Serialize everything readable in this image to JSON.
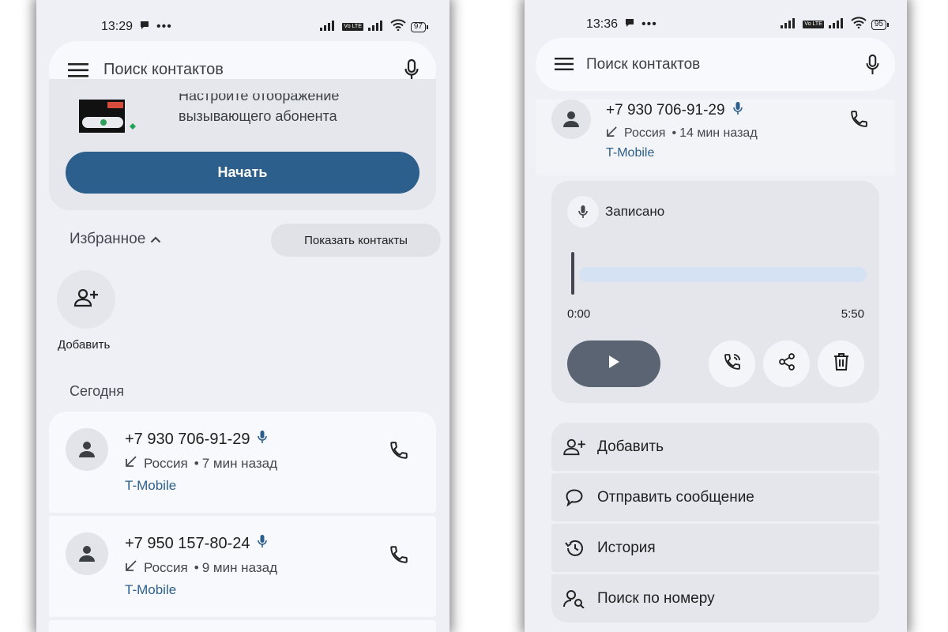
{
  "left": {
    "status": {
      "time": "13:29",
      "battery": "97",
      "volte": "Vo LTE"
    },
    "search": {
      "placeholder": "Поиск контактов"
    },
    "banner": {
      "line1": "Настройте отображение",
      "line2": "вызывающего абонента",
      "start_label": "Начать"
    },
    "favorites": {
      "label": "Избранное",
      "show_contacts": "Показать контакты",
      "add_label": "Добавить"
    },
    "today_label": "Сегодня",
    "calls": [
      {
        "number": "+7 930 706-91-29",
        "country": "Россия",
        "time": "7 мин назад",
        "carrier": "T-Mobile"
      },
      {
        "number": "+7 950 157-80-24",
        "country": "Россия",
        "time": "9 мин назад",
        "carrier": "T-Mobile"
      }
    ]
  },
  "right": {
    "status": {
      "time": "13:36",
      "battery": "95",
      "volte": "Vo LTE"
    },
    "search": {
      "placeholder": "Поиск контактов"
    },
    "call": {
      "number": "+7 930 706-91-29",
      "country": "Россия",
      "time": "14 мин назад",
      "carrier": "T-Mobile"
    },
    "recording": {
      "label": "Записано",
      "time_start": "0:00",
      "time_end": "5:50",
      "progress": 0.0
    },
    "actions": [
      {
        "label": "Добавить",
        "icon": "person-add-icon"
      },
      {
        "label": "Отправить сообщение",
        "icon": "message-icon"
      },
      {
        "label": "История",
        "icon": "history-icon"
      },
      {
        "label": "Поиск по номеру",
        "icon": "person-search-icon"
      }
    ]
  },
  "colors": {
    "accent": "#2c5f8c",
    "surface": "#eef0f5",
    "card": "#f8f9fc",
    "play": "#5a6472",
    "track": "#d5e2f4"
  }
}
